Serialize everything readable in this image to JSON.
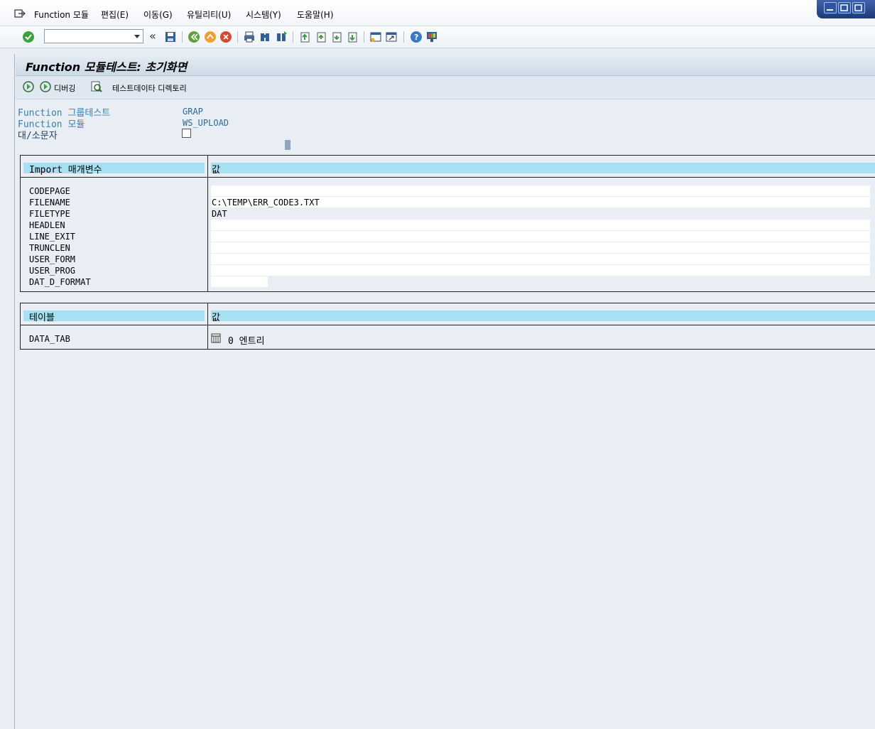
{
  "menu": {
    "items": [
      "Function 모듈",
      "편집(E)",
      "이동(G)",
      "유틸리티(U)",
      "시스템(Y)",
      "도움말(H)"
    ]
  },
  "toolbar": {
    "command_value": "",
    "icons": [
      "enter-icon",
      "save-icon",
      "back-icon",
      "exit-icon",
      "cancel-icon",
      "print-icon",
      "find-icon",
      "find-next-icon",
      "first-page-icon",
      "prev-page-icon",
      "next-page-icon",
      "last-page-icon",
      "new-session-icon",
      "shortcut-icon",
      "help-icon",
      "layout-icon"
    ]
  },
  "title": "Function 모듈테스트: 초기화면",
  "app_toolbar": {
    "debug_label": "디버깅",
    "testdata_label": "테스트데이타 디렉토리"
  },
  "header": {
    "group_label": "Function 그룹테스트",
    "group_value": "GRAP",
    "module_label": "Function 모듈",
    "module_value": "WS_UPLOAD",
    "case_label": "대/소문자",
    "case_checked": false
  },
  "import": {
    "col1": "Import 매개변수",
    "col2": "값",
    "rows": [
      {
        "name": "CODEPAGE",
        "value": ""
      },
      {
        "name": "FILENAME",
        "value": "C:\\TEMP\\ERR_CODE3.TXT"
      },
      {
        "name": "FILETYPE",
        "value": "DAT"
      },
      {
        "name": "HEADLEN",
        "value": ""
      },
      {
        "name": "LINE_EXIT",
        "value": ""
      },
      {
        "name": "TRUNCLEN",
        "value": ""
      },
      {
        "name": "USER_FORM",
        "value": ""
      },
      {
        "name": "USER_PROG",
        "value": ""
      },
      {
        "name": "DAT_D_FORMAT",
        "value": ""
      }
    ]
  },
  "tables": {
    "col1": "테이블",
    "col2": "값",
    "rows": [
      {
        "name": "DATA_TAB",
        "value": "0 엔트리"
      }
    ]
  }
}
